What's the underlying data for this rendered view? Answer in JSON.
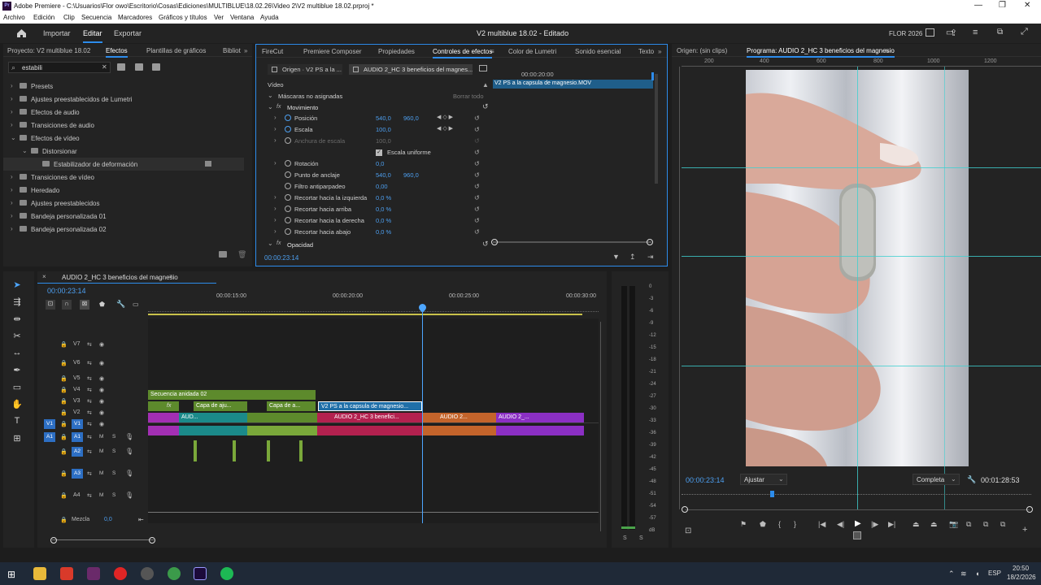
{
  "window": {
    "title": "Adobe Premiere - C:\\Usuarios\\Flor owo\\Escritorio\\Cosas\\Ediciones\\MULTIBLUE\\18.02.26\\Video 2\\V2 multiblue 18.02.prproj *",
    "app_icon": "Pr"
  },
  "menu": [
    "Archivo",
    "Edición",
    "Clip",
    "Secuencia",
    "Marcadores",
    "Gráficos y títulos",
    "Ver",
    "Ventana",
    "Ayuda"
  ],
  "workspace": {
    "tabs": [
      "Importar",
      "Editar",
      "Exportar"
    ],
    "active": "Editar",
    "project_title": "V2 multiblue 18.02 - Editado",
    "user": "FLOR 2026"
  },
  "effects_panel": {
    "tabs": [
      "Proyecto: V2 multiblue 18.02",
      "Efectos",
      "Plantillas de gráficos",
      "Bibliot"
    ],
    "active_tab": "Efectos",
    "search_value": "estabili",
    "items": [
      {
        "label": "Presets",
        "level": 0,
        "open": false
      },
      {
        "label": "Ajustes preestablecidos de Lumetri",
        "level": 0,
        "open": false
      },
      {
        "label": "Efectos de audio",
        "level": 0,
        "open": false
      },
      {
        "label": "Transiciones de audio",
        "level": 0,
        "open": false
      },
      {
        "label": "Efectos de vídeo",
        "level": 0,
        "open": true
      },
      {
        "label": "Distorsionar",
        "level": 1,
        "open": true
      },
      {
        "label": "Estabilizador de deformación",
        "level": 2,
        "open": false
      },
      {
        "label": "Transiciones de vídeo",
        "level": 0,
        "open": false
      },
      {
        "label": "Heredado",
        "level": 0,
        "open": false
      },
      {
        "label": "Ajustes preestablecidos",
        "level": 0,
        "open": false
      },
      {
        "label": "Bandeja personalizada 01",
        "level": 0,
        "open": false
      },
      {
        "label": "Bandeja personalizada 02",
        "level": 0,
        "open": false
      }
    ]
  },
  "effect_controls": {
    "tabs": [
      "FireCut",
      "Premiere Composer",
      "Propiedades",
      "Controles de efectos",
      "Color de Lumetri",
      "Sonido esencial",
      "Texto"
    ],
    "active_tab": "Controles de efectos",
    "source_tab": "Origen · V2 PS a la ...",
    "sequence_tab": "AUDIO 2_HC 3 beneficios del magnes...",
    "ruler_time": "00:00:20:00",
    "clip_name": "V2 PS a la capsula de magnesio.MOV",
    "section": "Vídeo",
    "masks": "Máscaras no asignadas",
    "reset_all": "Borrar todo",
    "movement": "Movimiento",
    "rows": [
      {
        "name": "Posición",
        "v1": "540,0",
        "v2": "960,0",
        "kf": true
      },
      {
        "name": "Escala",
        "v1": "100,0",
        "v2": "",
        "kf": true
      },
      {
        "name": "Anchura de escala",
        "v1": "100,0",
        "v2": "",
        "disabled": true
      },
      {
        "name": "Escala uniforme",
        "checkbox": true
      },
      {
        "name": "Rotación",
        "v1": "0,0",
        "v2": ""
      },
      {
        "name": "Punto de anclaje",
        "v1": "540,0",
        "v2": "960,0"
      },
      {
        "name": "Filtro antiparpadeo",
        "v1": "0,00",
        "v2": ""
      },
      {
        "name": "Recortar hacia la izquierda",
        "v1": "0,0 %",
        "v2": ""
      },
      {
        "name": "Recortar hacia arriba",
        "v1": "0,0 %",
        "v2": ""
      },
      {
        "name": "Recortar hacia la derecha",
        "v1": "0,0 %",
        "v2": ""
      },
      {
        "name": "Recortar hacia abajo",
        "v1": "0,0 %",
        "v2": ""
      }
    ],
    "opacity": "Opacidad",
    "timecode": "00:00:23:14"
  },
  "program_monitor": {
    "tabs": [
      "Origen: (sin clips)",
      "Programa: AUDIO 2_HC 3 beneficios del magnesio"
    ],
    "ruler_labels": [
      "200",
      "400",
      "600",
      "800",
      "1000",
      "1200"
    ],
    "timecode": "00:00:23:14",
    "fit": "Ajustar",
    "quality": "Completa",
    "duration": "00:01:28:53"
  },
  "timeline": {
    "sequence_name": "AUDIO 2_HC 3 beneficios del magnesio",
    "timecode": "00:00:23:14",
    "ruler": [
      "00:00:15:00",
      "00:00:20:00",
      "00:00:25:00",
      "00:00:30:00"
    ],
    "video_tracks": [
      "V7",
      "V6",
      "V5",
      "V4",
      "V3",
      "V2",
      "V1"
    ],
    "audio_tracks": [
      "A1",
      "A2",
      "A3",
      "A4"
    ],
    "mix_label": "Mezcla",
    "mix_value": "0,0",
    "clips": {
      "nested": "Secuencia anidada 02",
      "capa1": "Capa de aju...",
      "capa2": "Capa de a...",
      "selected": "V2 PS a la capsula de magnesio...",
      "aud": "AUD...",
      "audio_main": "AUDIO 2_HC 3 benefici...",
      "audio2": "AUDIO 2...",
      "audio3": "AUDIO 2_..."
    },
    "fx": "fx",
    "audio_meter_scale": [
      "0",
      "-3",
      "-6",
      "-9",
      "-12",
      "-15",
      "-18",
      "-21",
      "-24",
      "-27",
      "-30",
      "-33",
      "-36",
      "-39",
      "-42",
      "-45",
      "-48",
      "-51",
      "-54",
      "-57",
      "dB"
    ]
  },
  "taskbar": {
    "time": "20:50",
    "date": "18/2/2026",
    "lang": "ESP"
  }
}
